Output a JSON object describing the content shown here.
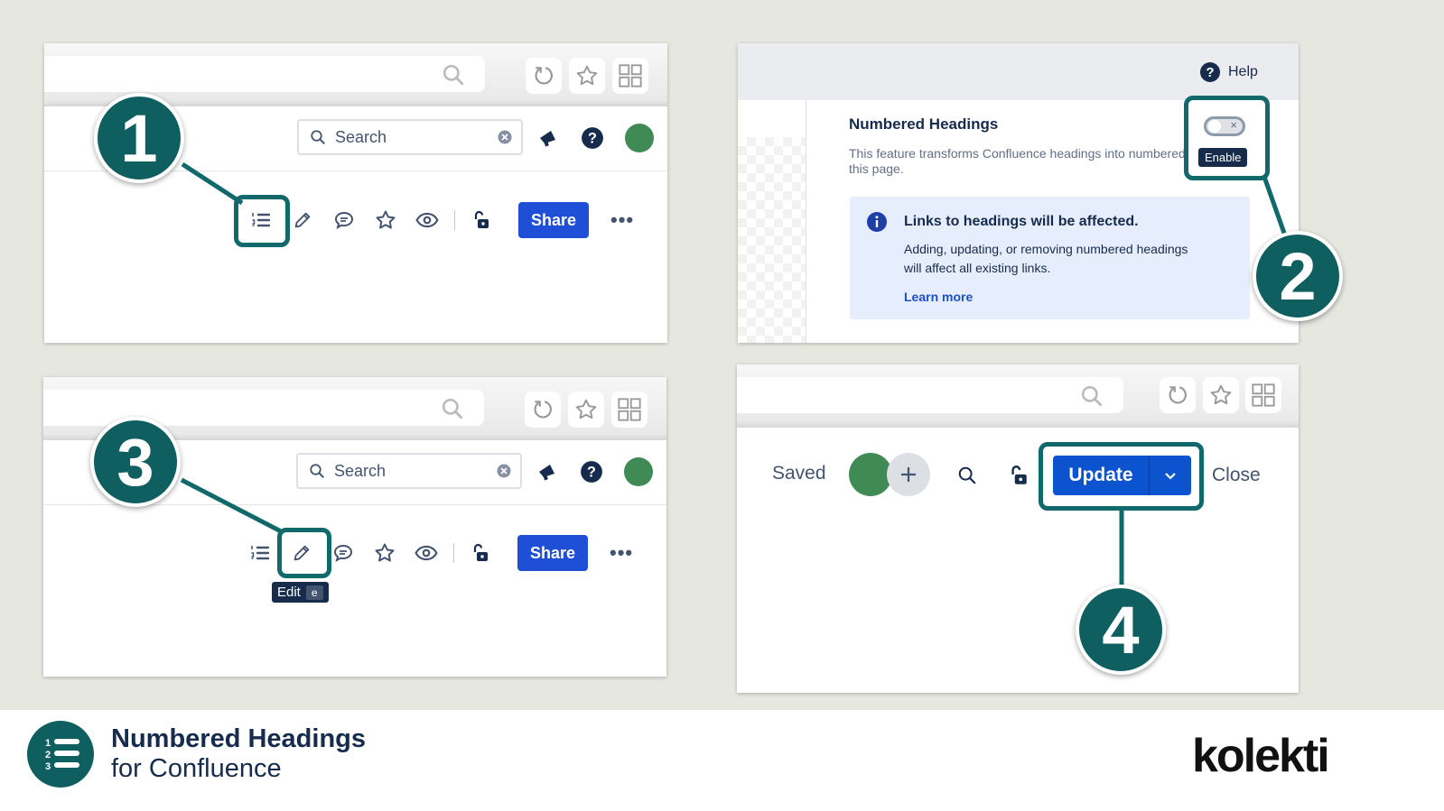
{
  "colors": {
    "accent": "#0f5f61",
    "primary_button": "#1f4fd6",
    "avatar": "#3f8a55",
    "info_bg": "#e6eefe"
  },
  "panel1": {
    "search_placeholder": "Search",
    "share_label": "Share",
    "step_number": "1"
  },
  "panel2": {
    "help_label": "Help",
    "feature_title": "Numbered Headings",
    "feature_desc_line1": "This feature transforms Confluence headings into numbered",
    "feature_desc_line2": "this page.",
    "toggle_tooltip": "Enable",
    "info_title": "Links to headings will be affected.",
    "info_line1": "Adding, updating, or removing numbered headings",
    "info_line2": "will affect all existing links.",
    "learn_more": "Learn more",
    "step_number": "2"
  },
  "panel3": {
    "search_placeholder": "Search",
    "share_label": "Share",
    "tooltip_label": "Edit",
    "tooltip_shortcut": "e",
    "step_number": "3"
  },
  "panel4": {
    "saved_label": "Saved",
    "update_label": "Update",
    "close_label": "Close",
    "step_number": "4"
  },
  "footer": {
    "product_line1": "Numbered Headings",
    "product_line2": "for Confluence",
    "logo_icon_digits": [
      "1",
      "2",
      "3"
    ],
    "brand_logo": "kolekti"
  }
}
